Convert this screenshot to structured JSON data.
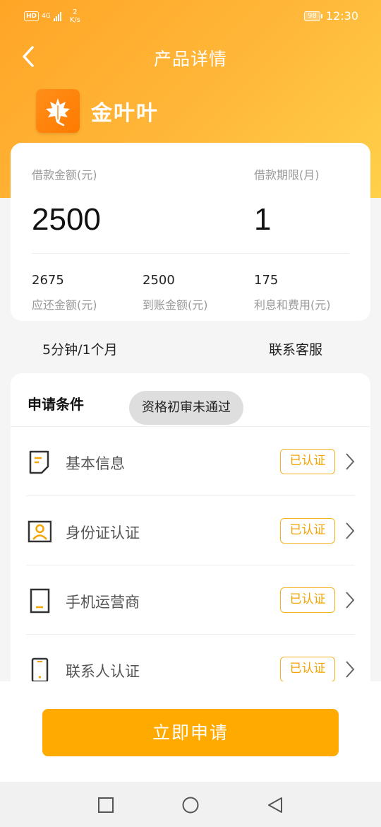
{
  "status_bar": {
    "hd": "HD",
    "network": "4G",
    "speed_value": "2",
    "speed_unit": "K/s",
    "battery": "98",
    "time": "12:30"
  },
  "header": {
    "title": "产品详情"
  },
  "brand": {
    "name": "金叶叶"
  },
  "loan": {
    "amount_label": "借款金额(元)",
    "amount": "2500",
    "term_label": "借款期限(月)",
    "term": "1",
    "repay_value": "2675",
    "repay_label": "应还金额(元)",
    "received_value": "2500",
    "received_label": "到账金额(元)",
    "fee_value": "175",
    "fee_label": "利息和费用(元)"
  },
  "info": {
    "duration": "5分钟/1个月",
    "service": "联系客服"
  },
  "conditions": {
    "title": "申请条件",
    "toast": "资格初审未通过",
    "items": [
      {
        "label": "基本信息",
        "status": "已认证",
        "icon": "document-icon"
      },
      {
        "label": "身份证认证",
        "status": "已认证",
        "icon": "id-card-icon"
      },
      {
        "label": "手机运营商",
        "status": "已认证",
        "icon": "tablet-icon"
      },
      {
        "label": "联系人认证",
        "status": "已认证",
        "icon": "phone-icon"
      }
    ]
  },
  "actions": {
    "apply_label": "立即申请"
  },
  "colors": {
    "accent": "#ffaa00",
    "badge": "#f5a400",
    "header_start": "#ffa526",
    "header_end": "#ffd04a"
  }
}
